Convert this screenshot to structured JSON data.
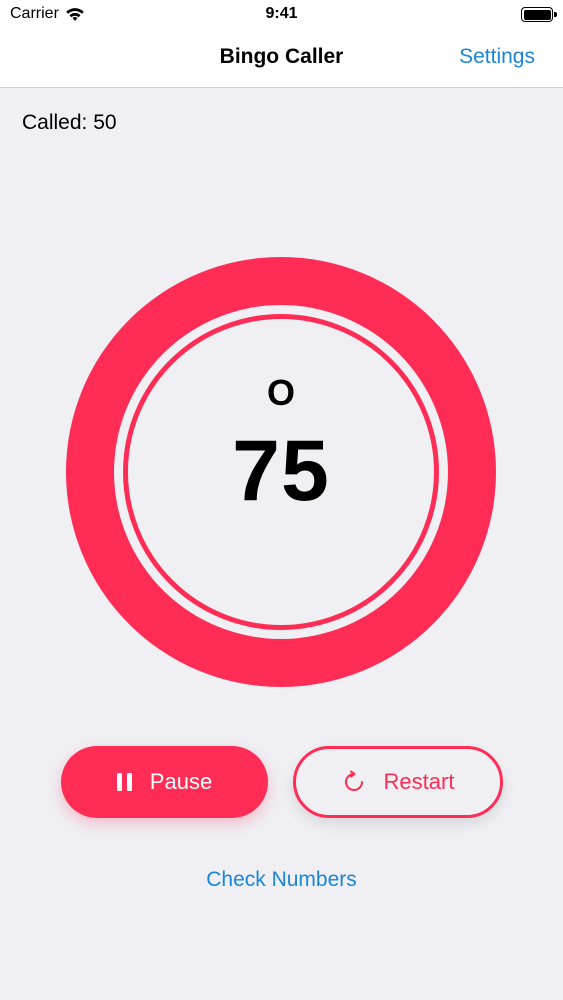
{
  "status_bar": {
    "carrier": "Carrier",
    "time": "9:41",
    "icons": [
      "wifi-icon",
      "battery-icon"
    ]
  },
  "nav": {
    "title": "Bingo Caller",
    "settings_label": "Settings"
  },
  "game": {
    "called_text": "Called: 50",
    "current_letter": "O",
    "current_number": "75"
  },
  "actions": {
    "pause_label": "Pause",
    "pause_icon": "pause-icon",
    "restart_label": "Restart",
    "restart_icon": "restart-icon",
    "check_numbers_label": "Check Numbers"
  },
  "colors": {
    "accent": "#ff2d55",
    "link": "#1a86d8",
    "background": "#efeff4"
  }
}
